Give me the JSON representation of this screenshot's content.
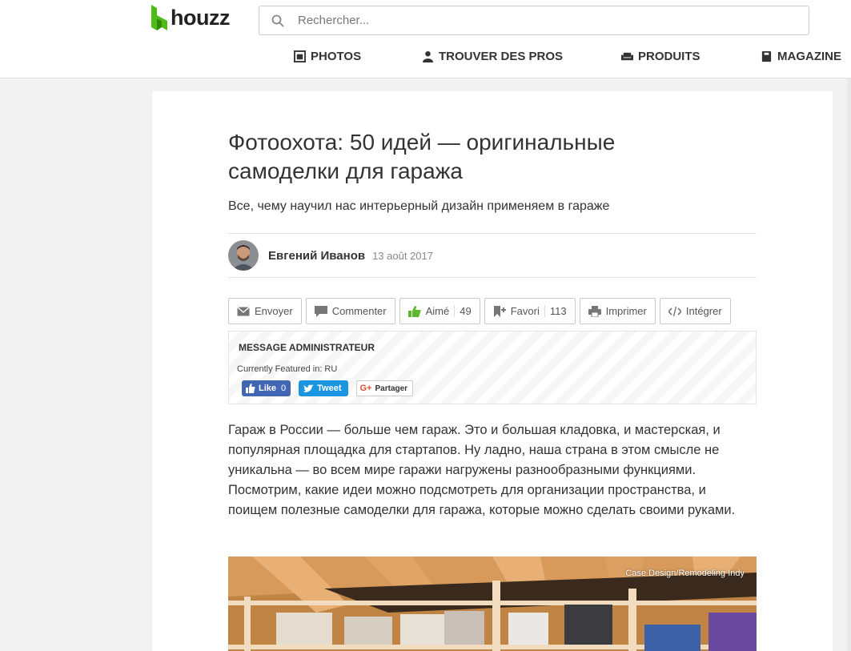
{
  "header": {
    "logo_text": "houzz",
    "search_placeholder": "Rechercher...",
    "nav": [
      {
        "label": "PHOTOS",
        "icon": "photos-icon"
      },
      {
        "label": "TROUVER DES PROS",
        "icon": "person-icon"
      },
      {
        "label": "PRODUITS",
        "icon": "sofa-icon"
      },
      {
        "label": "MAGAZINE",
        "icon": "book-icon"
      }
    ]
  },
  "article": {
    "title": "Фотоохота: 50 идей — оригинальные самоделки для гаража",
    "subtitle": "Все, чему научил нас интерьерный дизайн применяем в гараже",
    "author": "Евгений Иванов",
    "date": "13 août 2017",
    "actions": {
      "send": "Envoyer",
      "comment": "Commenter",
      "like": "Aimé",
      "like_count": "49",
      "favorite": "Favori",
      "favorite_count": "113",
      "print": "Imprimer",
      "embed": "Intégrer"
    },
    "admin": {
      "title": "MESSAGE ADMINISTRATEUR",
      "featured": "Currently Featured in: RU",
      "fb_like": "Like",
      "fb_count": "0",
      "tweet": "Tweet",
      "gplus_logo": "G+",
      "gplus": "Partager"
    },
    "body": "Гараж в России — больше чем гараж. Это и большая кладовка, и мастерская, и популярная площадка для стартапов. Ну ладно, наша страна в этом смысле не уникальна — во всем мире гаражи нагружены разнообразными функциями. Посмотрим, какие идеи можно подсмотреть для организации пространства, и поищем полезные самоделки для гаража, которые можно сделать своими руками.",
    "photo_credit": "Case Design/Remodeling Indy"
  },
  "colors": {
    "brand_green": "#4dbc15",
    "fb_blue": "#4267b2",
    "twitter_blue": "#1b95e0"
  }
}
